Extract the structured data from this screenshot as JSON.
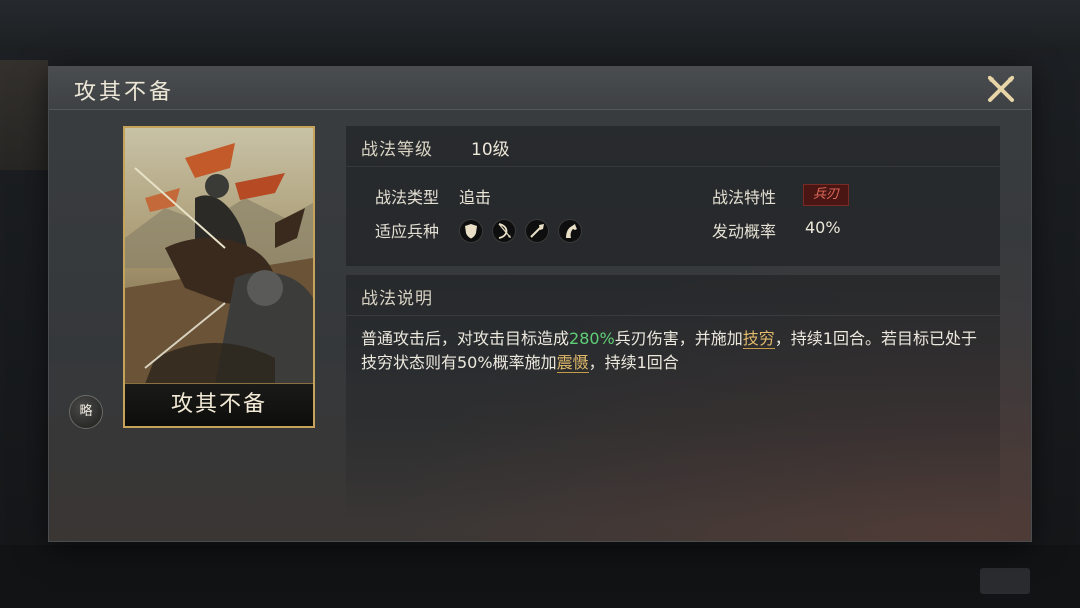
{
  "dialog": {
    "title": "攻其不备",
    "card_name": "攻其不备",
    "strategy_button": "略"
  },
  "info": {
    "level_label": "战法等级",
    "level_value": "10级",
    "type_label": "战法类型",
    "type_value": "追击",
    "trait_label": "战法特性",
    "trait_value": "兵刃",
    "units_label": "适应兵种",
    "units": [
      "shield-icon",
      "bow-icon",
      "spear-icon",
      "horse-icon"
    ],
    "rate_label": "发动概率",
    "rate_value": "40%"
  },
  "description": {
    "title": "战法说明",
    "seg1": "普通攻击后，对攻击目标造成",
    "dmg": "280%",
    "seg2": "兵刃伤害，并施加",
    "link1": "技穷",
    "seg3": "，持续1回合。若目标已处于技穷状态则有50%概率施加",
    "link2": "震慑",
    "seg4": "，持续1回合"
  },
  "colors": {
    "accent_gold": "#c6a35a",
    "damage_green": "#5fcf77",
    "trait_red": "#e06a5a"
  }
}
